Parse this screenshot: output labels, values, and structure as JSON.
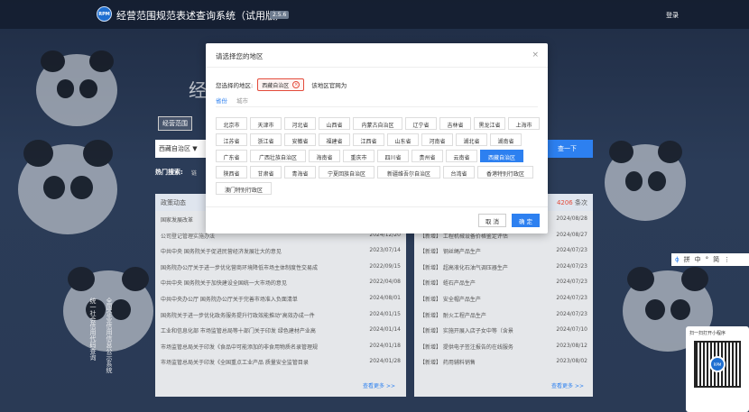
{
  "header": {
    "app_title": "经营范围规范表述查询系统（试用版）",
    "version": "2.5.6",
    "login_label": "登录",
    "logo_text": "RPM"
  },
  "hero": {
    "title_partial": "经",
    "scope_tag": "经营范围",
    "region_value": "西藏自治区 ▼",
    "search_label": "查一下",
    "hot_label": "热门搜索:",
    "hot_sub": "链"
  },
  "left_panel": {
    "tab": "政策动态",
    "rows": [
      {
        "t": "国家发展改革",
        "d": ""
      },
      {
        "t": "公司登记管理实施办法",
        "d": "2024/12/20"
      },
      {
        "t": "中共中央 国务院关于促进民营经济发展壮大的意见",
        "d": "2023/07/14"
      },
      {
        "t": "国务院办公厅关于进一步优化营商环境降低市场主体制度性交易成",
        "d": "2022/09/15"
      },
      {
        "t": "中共中央 国务院关于加快建设全国统一大市场的意见",
        "d": "2022/04/08"
      },
      {
        "t": "中共中央办公厅 国务院办公厅关于完善市场准入负面清单",
        "d": "2024/08/01"
      },
      {
        "t": "国务院关于进一步优化政务服务提升行政效能推动\"高效办成一件",
        "d": "2024/01/15"
      },
      {
        "t": "工业和信息化部 市场监管总局等十部门关于印发 绿色建材产业高",
        "d": "2024/01/14"
      },
      {
        "t": "市场监管总局关于印发《食品中可能添加的非食用物质名录管理规",
        "d": "2024/01/18"
      },
      {
        "t": "市场监管总局关于印发《全国重点工业产品 质量安全监管目录",
        "d": "2024/01/28"
      }
    ],
    "more": "查看更多 >>"
  },
  "right_panel": {
    "count_num": "4206",
    "count_label": " 条次",
    "rows": [
      {
        "t": "",
        "d": "2024/08/28"
      },
      {
        "t": "【新增】 工程机械设备价格鉴定评估",
        "d": "2024/08/27"
      },
      {
        "t": "【新增】 钢丝绳产品生产",
        "d": "2024/07/23"
      },
      {
        "t": "【新增】 超高液化石油气调压器生产",
        "d": "2024/07/23"
      },
      {
        "t": "【新增】 蛭石产品生产",
        "d": "2024/07/23"
      },
      {
        "t": "【新增】 安全帽产品生产",
        "d": "2024/07/23"
      },
      {
        "t": "【新增】 耐火工程产品生产",
        "d": "2024/07/23"
      },
      {
        "t": "【新增】 实施开展入店子女中等（含景",
        "d": "2024/07/10"
      },
      {
        "t": "【新增】 提供电子签注报告的在线服务",
        "d": "2023/08/12"
      },
      {
        "t": "【新增】 药用辅料销售",
        "d": "2023/08/02"
      }
    ],
    "more": "查看更多 >>"
  },
  "side_texts": [
    "统一社会信用代码查询",
    "全国企业信用信息公示系统"
  ],
  "toolbar_items": [
    "拼",
    "中",
    "°",
    "简",
    "⋮"
  ],
  "qr": {
    "caption": "扫一扫打开小程序",
    "close": "×",
    "center": "RPM"
  },
  "modal": {
    "title": "请选择您的地区",
    "close": "×",
    "selected_label": "您选择的地区:",
    "selected_value": "西藏自治区",
    "note": "该地区官网为",
    "tab_province": "省份",
    "tab_city": "城市",
    "provinces": [
      "北京市",
      "天津市",
      "河北省",
      "山西省",
      "内蒙古自治区",
      "辽宁省",
      "吉林省",
      "黑龙江省",
      "上海市",
      "江苏省",
      "浙江省",
      "安徽省",
      "福建省",
      "江西省",
      "山东省",
      "河南省",
      "湖北省",
      "湖南省",
      "广东省",
      "广西壮族自治区",
      "海南省",
      "重庆市",
      "四川省",
      "贵州省",
      "云南省",
      "西藏自治区",
      "陕西省",
      "甘肃省",
      "青海省",
      "宁夏回族自治区",
      "新疆维吾尔自治区",
      "台湾省",
      "香港特别行政区",
      "澳门特别行政区"
    ],
    "selected_index": 25,
    "cancel_label": "取 消",
    "ok_label": "确 定"
  }
}
